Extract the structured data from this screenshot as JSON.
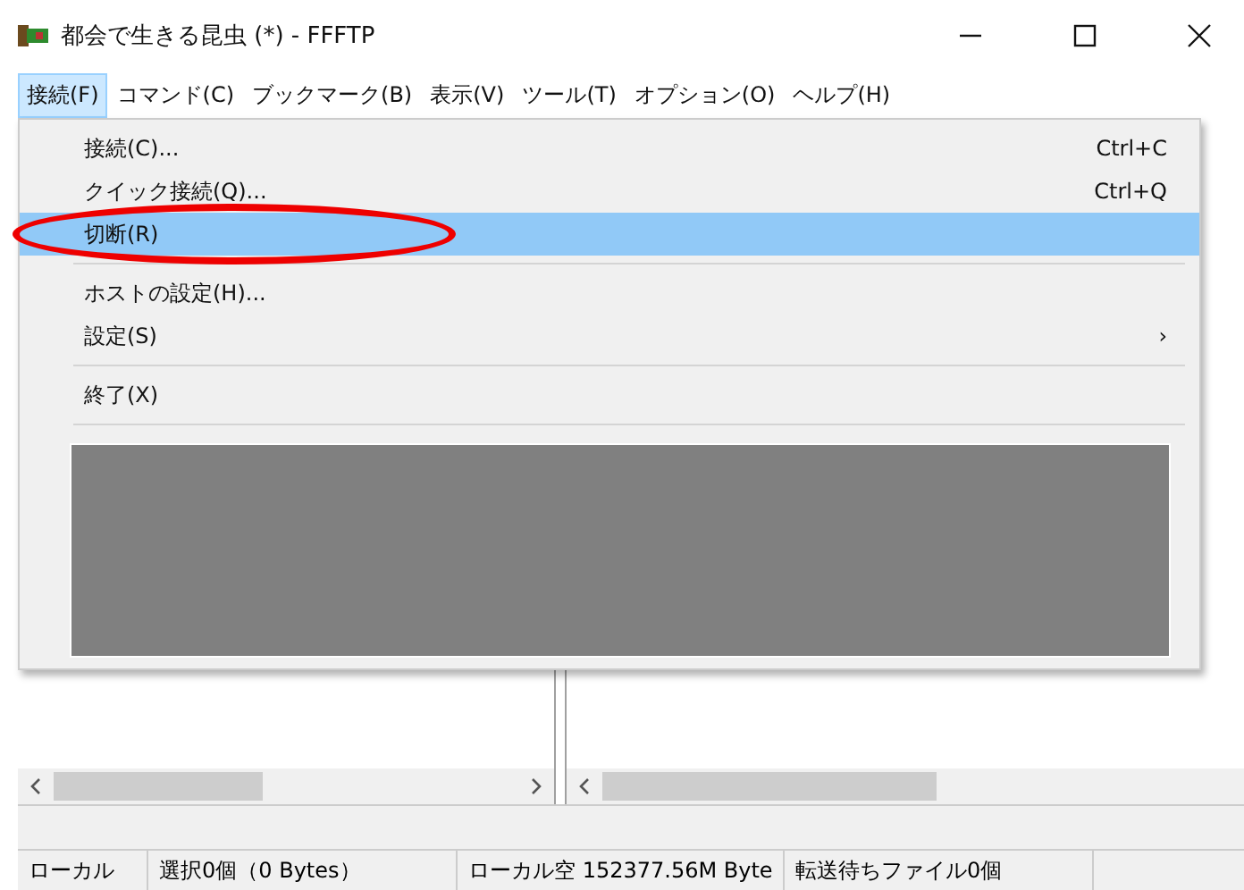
{
  "window": {
    "title": "都会で生きる昆虫 (*) - FFFTP"
  },
  "menubar": [
    {
      "label": "接続(F)",
      "selected": true
    },
    {
      "label": "コマンド(C)",
      "selected": false
    },
    {
      "label": "ブックマーク(B)",
      "selected": false
    },
    {
      "label": "表示(V)",
      "selected": false
    },
    {
      "label": "ツール(T)",
      "selected": false
    },
    {
      "label": "オプション(O)",
      "selected": false
    },
    {
      "label": "ヘルプ(H)",
      "selected": false
    }
  ],
  "menu": [
    {
      "kind": "item",
      "label": "接続(C)...",
      "shortcut": "Ctrl+C",
      "selected": false
    },
    {
      "kind": "item",
      "label": "クイック接続(Q)...",
      "shortcut": "Ctrl+Q",
      "selected": false
    },
    {
      "kind": "item",
      "label": "切断(R)",
      "selected": true,
      "circled": true
    },
    {
      "kind": "separator"
    },
    {
      "kind": "item",
      "label": "ホストの設定(H)...",
      "selected": false
    },
    {
      "kind": "submenu",
      "label": "設定(S)",
      "arrow": "›",
      "selected": false
    },
    {
      "kind": "separator"
    },
    {
      "kind": "item",
      "label": "終了(X)",
      "selected": false
    },
    {
      "kind": "separator"
    },
    {
      "kind": "redacted"
    }
  ],
  "status_bar": [
    "ローカル",
    "選択0個（0 Bytes）",
    "ローカル空 152377.56M Byte",
    "転送待ちファイル0個"
  ]
}
